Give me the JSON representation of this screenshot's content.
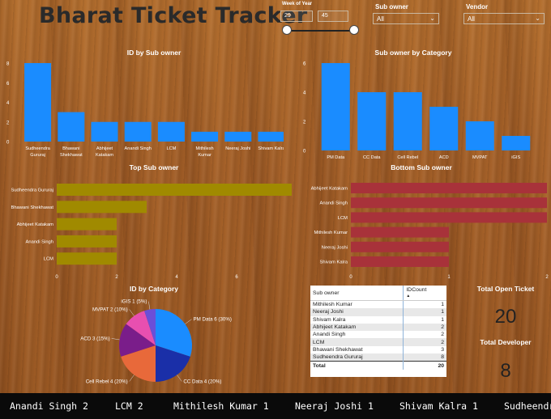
{
  "title": "Bharat Ticket Tracker",
  "week_slicer": {
    "label": "Week of Year",
    "min": "29",
    "max": "45",
    "range_low": 0.0,
    "range_high": 1.0
  },
  "sub_owner_filter": {
    "label": "Sub owner",
    "value": "All"
  },
  "vendor_filter": {
    "label": "Vendor",
    "value": "All"
  },
  "colors": {
    "blue": "#1a8cff",
    "olive": "#a08a00",
    "crimson": "#a8323a"
  },
  "chart_data": [
    {
      "type": "bar",
      "title": "ID by Sub owner",
      "categories": [
        "Sudheendra Gururaj",
        "Bhawani Shekhawat",
        "Abhijeet Katakam",
        "Anandi Singh",
        "LCM",
        "Mithilesh Kumar",
        "Neeraj Joshi",
        "Shivam Kalra"
      ],
      "category_labels": [
        [
          "Sudheendra",
          "Gururaj"
        ],
        [
          "Bhawani",
          "Shekhawat"
        ],
        [
          "Abhijeet",
          "Katakam"
        ],
        [
          "Anandi Singh"
        ],
        [
          "LCM"
        ],
        [
          "Mithilesh",
          "Kumar"
        ],
        [
          "Neeraj Joshi"
        ],
        [
          "Shivam Kalra"
        ]
      ],
      "values": [
        8,
        3,
        2,
        2,
        2,
        1,
        1,
        1
      ],
      "ylim": [
        0,
        8
      ],
      "yticks": [
        "0",
        "2",
        "4",
        "6",
        "8"
      ]
    },
    {
      "type": "bar",
      "title": "Sub owner by Category",
      "categories": [
        "PM Data",
        "CC Data",
        "Cell Rebel",
        "ACD",
        "MVPAT",
        "iGIS"
      ],
      "values": [
        6,
        4,
        4,
        3,
        2,
        1
      ],
      "ylim": [
        0,
        6
      ],
      "yticks": [
        "0",
        "2",
        "4",
        "6"
      ]
    },
    {
      "type": "bar",
      "orientation": "horizontal",
      "title": "Top Sub owner",
      "categories": [
        "Sudheendra Gururaj",
        "Bhawani Shekhawat",
        "Abhijeet Katakam",
        "Anandi Singh",
        "LCM"
      ],
      "values": [
        8,
        3,
        2,
        2,
        2
      ],
      "xlim": [
        0,
        8
      ],
      "xticks": [
        "0",
        "2",
        "4",
        "6",
        "8"
      ]
    },
    {
      "type": "bar",
      "orientation": "horizontal",
      "title": "Bottom Sub owner",
      "categories": [
        "Abhijeet Katakam",
        "Anandi Singh",
        "LCM",
        "Mithilesh Kumar",
        "Neeraj Joshi",
        "Shivam Kalra"
      ],
      "values": [
        2,
        2,
        2,
        1,
        1,
        1
      ],
      "xlim": [
        0,
        2
      ],
      "xticks": [
        "0",
        "1",
        "2"
      ]
    },
    {
      "type": "pie",
      "title": "ID by Category",
      "categories": [
        "PM Data",
        "CC Data",
        "Cell Rebel",
        "ACD",
        "MVPAT",
        "iGIS"
      ],
      "values": [
        6,
        4,
        4,
        3,
        2,
        1
      ],
      "labels": [
        "PM Data 6 (30%)",
        "CC Data 4 (20%)",
        "Cell Rebel 4 (20%)",
        "ACD 3 (15%)",
        "MVPAT 2 (10%)",
        "iGIS 1 (5%)"
      ],
      "colors": [
        "#1a8cff",
        "#1a2fa8",
        "#e8693a",
        "#7a1d8a",
        "#e84fb0",
        "#6b4fd8"
      ]
    }
  ],
  "table": {
    "headers": [
      "Sub owner",
      "IDCount"
    ],
    "rows": [
      [
        "Mithilesh Kumar",
        "1"
      ],
      [
        "Neeraj Joshi",
        "1"
      ],
      [
        "Shivam Kalra",
        "1"
      ],
      [
        "Abhijeet Katakam",
        "2"
      ],
      [
        "Anandi Singh",
        "2"
      ],
      [
        "LCM",
        "2"
      ],
      [
        "Bhawani Shekhawat",
        "3"
      ],
      [
        "Sudheendra Gururaj",
        "8"
      ]
    ],
    "total": [
      "Total",
      "20"
    ]
  },
  "kpis": {
    "open_ticket_label": "Total Open Ticket",
    "open_ticket_value": "20",
    "developer_label": "Total Developer",
    "developer_value": "8"
  },
  "ticker": [
    "Anandi Singh 2",
    "LCM 2",
    "Mithilesh Kumar 1",
    "Neeraj Joshi 1",
    "Shivam Kalra 1",
    "Sudheendr"
  ]
}
